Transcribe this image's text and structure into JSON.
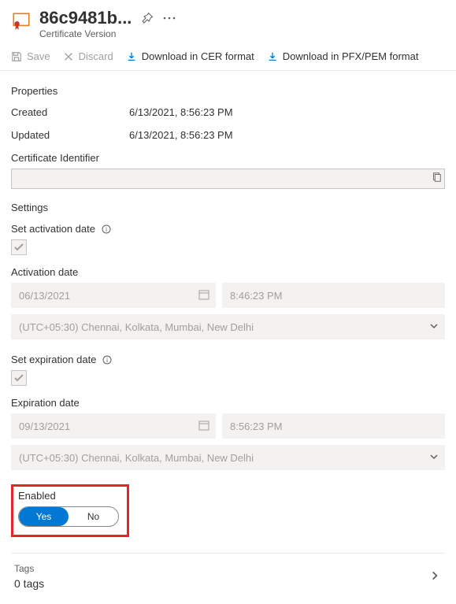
{
  "header": {
    "title": "86c9481b...",
    "subtitle": "Certificate Version"
  },
  "toolbar": {
    "save": "Save",
    "discard": "Discard",
    "download_cer": "Download in CER format",
    "download_pfx": "Download in PFX/PEM format"
  },
  "properties": {
    "section": "Properties",
    "created_label": "Created",
    "created_value": "6/13/2021, 8:56:23 PM",
    "updated_label": "Updated",
    "updated_value": "6/13/2021, 8:56:23 PM",
    "cert_id_label": "Certificate Identifier",
    "cert_id_value": ""
  },
  "settings": {
    "section": "Settings",
    "activation_toggle_label": "Set activation date",
    "activation_date_label": "Activation date",
    "activation_date": "06/13/2021",
    "activation_time": "8:46:23 PM",
    "activation_tz": "(UTC+05:30) Chennai, Kolkata, Mumbai, New Delhi",
    "expiration_toggle_label": "Set expiration date",
    "expiration_date_label": "Expiration date",
    "expiration_date": "09/13/2021",
    "expiration_time": "8:56:23 PM",
    "expiration_tz": "(UTC+05:30) Chennai, Kolkata, Mumbai, New Delhi",
    "enabled_label": "Enabled",
    "enabled_yes": "Yes",
    "enabled_no": "No"
  },
  "tags": {
    "label": "Tags",
    "count": "0 tags"
  }
}
